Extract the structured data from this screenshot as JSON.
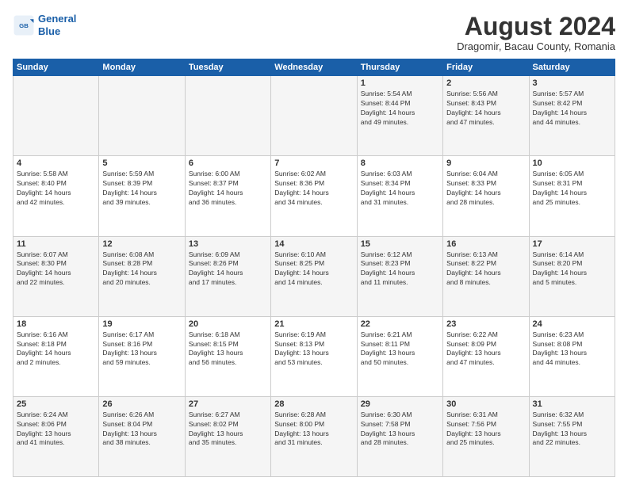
{
  "header": {
    "logo_line1": "General",
    "logo_line2": "Blue",
    "month": "August 2024",
    "location": "Dragomir, Bacau County, Romania"
  },
  "weekdays": [
    "Sunday",
    "Monday",
    "Tuesday",
    "Wednesday",
    "Thursday",
    "Friday",
    "Saturday"
  ],
  "weeks": [
    [
      {
        "day": "",
        "info": ""
      },
      {
        "day": "",
        "info": ""
      },
      {
        "day": "",
        "info": ""
      },
      {
        "day": "",
        "info": ""
      },
      {
        "day": "1",
        "info": "Sunrise: 5:54 AM\nSunset: 8:44 PM\nDaylight: 14 hours\nand 49 minutes."
      },
      {
        "day": "2",
        "info": "Sunrise: 5:56 AM\nSunset: 8:43 PM\nDaylight: 14 hours\nand 47 minutes."
      },
      {
        "day": "3",
        "info": "Sunrise: 5:57 AM\nSunset: 8:42 PM\nDaylight: 14 hours\nand 44 minutes."
      }
    ],
    [
      {
        "day": "4",
        "info": "Sunrise: 5:58 AM\nSunset: 8:40 PM\nDaylight: 14 hours\nand 42 minutes."
      },
      {
        "day": "5",
        "info": "Sunrise: 5:59 AM\nSunset: 8:39 PM\nDaylight: 14 hours\nand 39 minutes."
      },
      {
        "day": "6",
        "info": "Sunrise: 6:00 AM\nSunset: 8:37 PM\nDaylight: 14 hours\nand 36 minutes."
      },
      {
        "day": "7",
        "info": "Sunrise: 6:02 AM\nSunset: 8:36 PM\nDaylight: 14 hours\nand 34 minutes."
      },
      {
        "day": "8",
        "info": "Sunrise: 6:03 AM\nSunset: 8:34 PM\nDaylight: 14 hours\nand 31 minutes."
      },
      {
        "day": "9",
        "info": "Sunrise: 6:04 AM\nSunset: 8:33 PM\nDaylight: 14 hours\nand 28 minutes."
      },
      {
        "day": "10",
        "info": "Sunrise: 6:05 AM\nSunset: 8:31 PM\nDaylight: 14 hours\nand 25 minutes."
      }
    ],
    [
      {
        "day": "11",
        "info": "Sunrise: 6:07 AM\nSunset: 8:30 PM\nDaylight: 14 hours\nand 22 minutes."
      },
      {
        "day": "12",
        "info": "Sunrise: 6:08 AM\nSunset: 8:28 PM\nDaylight: 14 hours\nand 20 minutes."
      },
      {
        "day": "13",
        "info": "Sunrise: 6:09 AM\nSunset: 8:26 PM\nDaylight: 14 hours\nand 17 minutes."
      },
      {
        "day": "14",
        "info": "Sunrise: 6:10 AM\nSunset: 8:25 PM\nDaylight: 14 hours\nand 14 minutes."
      },
      {
        "day": "15",
        "info": "Sunrise: 6:12 AM\nSunset: 8:23 PM\nDaylight: 14 hours\nand 11 minutes."
      },
      {
        "day": "16",
        "info": "Sunrise: 6:13 AM\nSunset: 8:22 PM\nDaylight: 14 hours\nand 8 minutes."
      },
      {
        "day": "17",
        "info": "Sunrise: 6:14 AM\nSunset: 8:20 PM\nDaylight: 14 hours\nand 5 minutes."
      }
    ],
    [
      {
        "day": "18",
        "info": "Sunrise: 6:16 AM\nSunset: 8:18 PM\nDaylight: 14 hours\nand 2 minutes."
      },
      {
        "day": "19",
        "info": "Sunrise: 6:17 AM\nSunset: 8:16 PM\nDaylight: 13 hours\nand 59 minutes."
      },
      {
        "day": "20",
        "info": "Sunrise: 6:18 AM\nSunset: 8:15 PM\nDaylight: 13 hours\nand 56 minutes."
      },
      {
        "day": "21",
        "info": "Sunrise: 6:19 AM\nSunset: 8:13 PM\nDaylight: 13 hours\nand 53 minutes."
      },
      {
        "day": "22",
        "info": "Sunrise: 6:21 AM\nSunset: 8:11 PM\nDaylight: 13 hours\nand 50 minutes."
      },
      {
        "day": "23",
        "info": "Sunrise: 6:22 AM\nSunset: 8:09 PM\nDaylight: 13 hours\nand 47 minutes."
      },
      {
        "day": "24",
        "info": "Sunrise: 6:23 AM\nSunset: 8:08 PM\nDaylight: 13 hours\nand 44 minutes."
      }
    ],
    [
      {
        "day": "25",
        "info": "Sunrise: 6:24 AM\nSunset: 8:06 PM\nDaylight: 13 hours\nand 41 minutes."
      },
      {
        "day": "26",
        "info": "Sunrise: 6:26 AM\nSunset: 8:04 PM\nDaylight: 13 hours\nand 38 minutes."
      },
      {
        "day": "27",
        "info": "Sunrise: 6:27 AM\nSunset: 8:02 PM\nDaylight: 13 hours\nand 35 minutes."
      },
      {
        "day": "28",
        "info": "Sunrise: 6:28 AM\nSunset: 8:00 PM\nDaylight: 13 hours\nand 31 minutes."
      },
      {
        "day": "29",
        "info": "Sunrise: 6:30 AM\nSunset: 7:58 PM\nDaylight: 13 hours\nand 28 minutes."
      },
      {
        "day": "30",
        "info": "Sunrise: 6:31 AM\nSunset: 7:56 PM\nDaylight: 13 hours\nand 25 minutes."
      },
      {
        "day": "31",
        "info": "Sunrise: 6:32 AM\nSunset: 7:55 PM\nDaylight: 13 hours\nand 22 minutes."
      }
    ]
  ]
}
